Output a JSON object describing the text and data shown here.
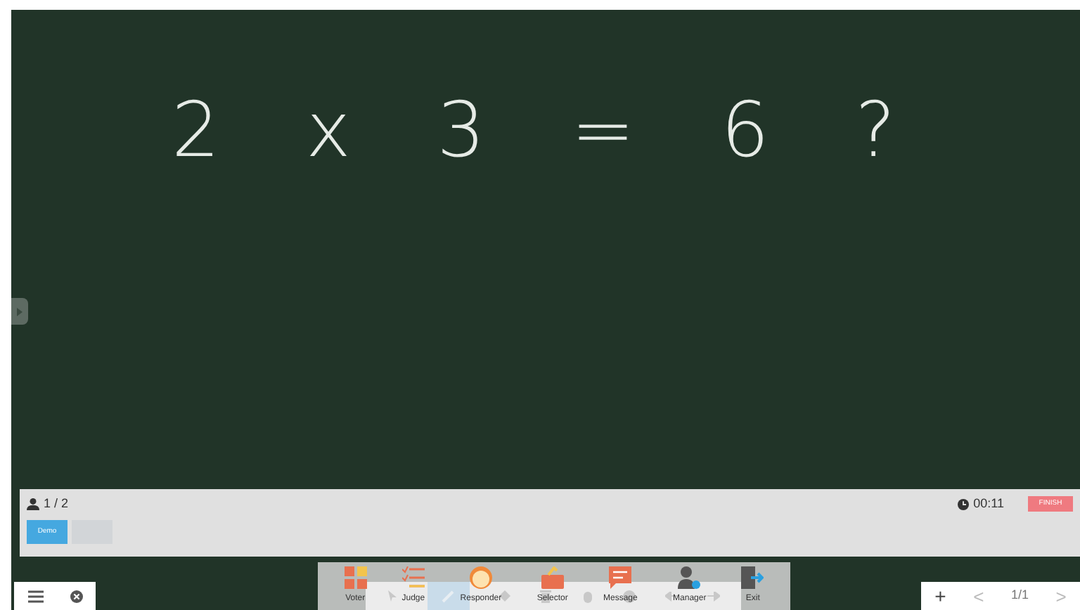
{
  "board": {
    "ink": "2 x 3 = 6 ?"
  },
  "panel": {
    "count": "1 / 2",
    "timer": "00:11",
    "finish": "FINISH",
    "tiles": [
      {
        "label": "Demo",
        "selected": true
      },
      {
        "selected": false
      }
    ]
  },
  "toolbar": [
    {
      "kind": "voter",
      "label": "Voter"
    },
    {
      "kind": "judge",
      "label": "Judge"
    },
    {
      "kind": "responder",
      "label": "Responder"
    },
    {
      "kind": "selector",
      "label": "Selector"
    },
    {
      "kind": "message",
      "label": "Message"
    },
    {
      "kind": "manager",
      "label": "Manager"
    },
    {
      "kind": "exit",
      "label": "Exit"
    }
  ],
  "pager": {
    "add": "+",
    "prev": "<",
    "page": "1/1",
    "next": ">"
  }
}
